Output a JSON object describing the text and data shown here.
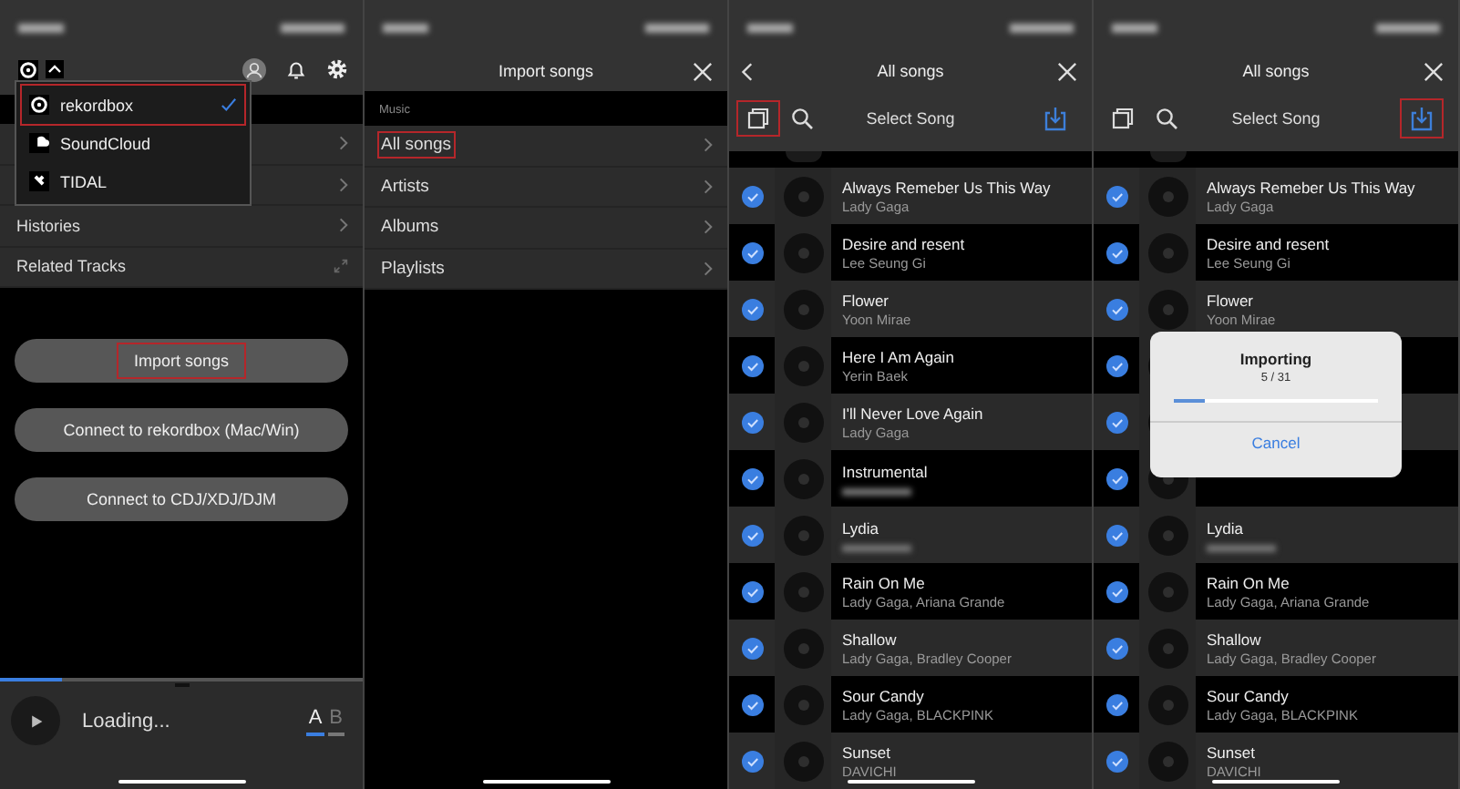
{
  "home_screen": {
    "source_menu": {
      "items": [
        {
          "kind": "rekordbox",
          "label": "rekordbox",
          "selected": true,
          "highlighted": true
        },
        {
          "kind": "soundcloud",
          "label": "SoundCloud",
          "selected": false,
          "highlighted": false
        },
        {
          "kind": "tidal",
          "label": "TIDAL",
          "selected": false,
          "highlighted": false
        }
      ]
    },
    "list_rows": [
      {
        "kind": "chevron"
      },
      {
        "kind": "chevron"
      },
      {
        "kind": "chevron",
        "label": "Histories"
      },
      {
        "kind": "expand",
        "label": "Related Tracks"
      }
    ],
    "buttons": [
      {
        "label": "Import songs",
        "highlighted": true
      },
      {
        "label": "Connect to rekordbox (Mac/Win)",
        "highlighted": false
      },
      {
        "label": "Connect to CDJ/XDJ/DJM",
        "highlighted": false
      }
    ],
    "player": {
      "level": 0.17,
      "status": "Loading...",
      "decks": [
        {
          "label": "A",
          "selected": true
        },
        {
          "label": "B",
          "selected": false
        }
      ]
    }
  },
  "import_screen": {
    "title": "Import songs",
    "section": "Music",
    "items": [
      {
        "label": "All songs",
        "highlighted": true
      },
      {
        "label": "Artists",
        "highlighted": false
      },
      {
        "label": "Albums",
        "highlighted": false
      },
      {
        "label": "Playlists",
        "highlighted": false
      }
    ]
  },
  "song_screens": [
    {
      "title": "All songs",
      "back": true,
      "toolbar_title": "Select Song",
      "copy_highlighted": true,
      "import_highlighted": false,
      "songs": [
        {
          "title": "Always  Remeber Us This Way",
          "artist": "Lady Gaga",
          "checked": true
        },
        {
          "title": "Desire and resent",
          "artist": "Lee Seung Gi",
          "checked": true
        },
        {
          "title": "Flower",
          "artist": "Yoon Mirae",
          "checked": true
        },
        {
          "title": "Here I Am Again",
          "artist": "Yerin Baek",
          "checked": true
        },
        {
          "title": "I'll Never Love Again",
          "artist": "Lady Gaga",
          "checked": true
        },
        {
          "title": "Instrumental",
          "checked": true
        },
        {
          "title": "Lydia",
          "checked": true
        },
        {
          "title": "Rain On Me",
          "artist": "Lady Gaga, Ariana Grande",
          "checked": true
        },
        {
          "title": "Shallow",
          "artist": "Lady Gaga, Bradley Cooper",
          "checked": true
        },
        {
          "title": "Sour Candy",
          "artist": "Lady Gaga, BLACKPINK",
          "checked": true
        },
        {
          "title": "Sunset",
          "artist": "DAVICHI",
          "checked": true
        }
      ]
    },
    {
      "title": "All songs",
      "back": false,
      "toolbar_title": "Select Song",
      "copy_highlighted": false,
      "import_highlighted": true,
      "songs": [
        {
          "title": "Always  Remeber Us This Way",
          "artist": "Lady Gaga",
          "checked": true
        },
        {
          "title": "Desire and resent",
          "artist": "Lee Seung Gi",
          "checked": true
        },
        {
          "title": "Flower",
          "artist": "Yoon Mirae",
          "checked": true
        },
        {
          "checked": true
        },
        {
          "checked": true
        },
        {
          "checked": true
        },
        {
          "title": "Lydia",
          "checked": true
        },
        {
          "title": "Rain On Me",
          "artist": "Lady Gaga, Ariana Grande",
          "checked": true
        },
        {
          "title": "Shallow",
          "artist": "Lady Gaga, Bradley Cooper",
          "checked": true
        },
        {
          "title": "Sour Candy",
          "artist": "Lady Gaga, BLACKPINK",
          "checked": true
        },
        {
          "title": "Sunset",
          "artist": "DAVICHI",
          "checked": true
        }
      ],
      "dialog": {
        "title": "Importing",
        "progress": "5 / 31",
        "level": 0.15,
        "button": "Cancel"
      }
    }
  ]
}
